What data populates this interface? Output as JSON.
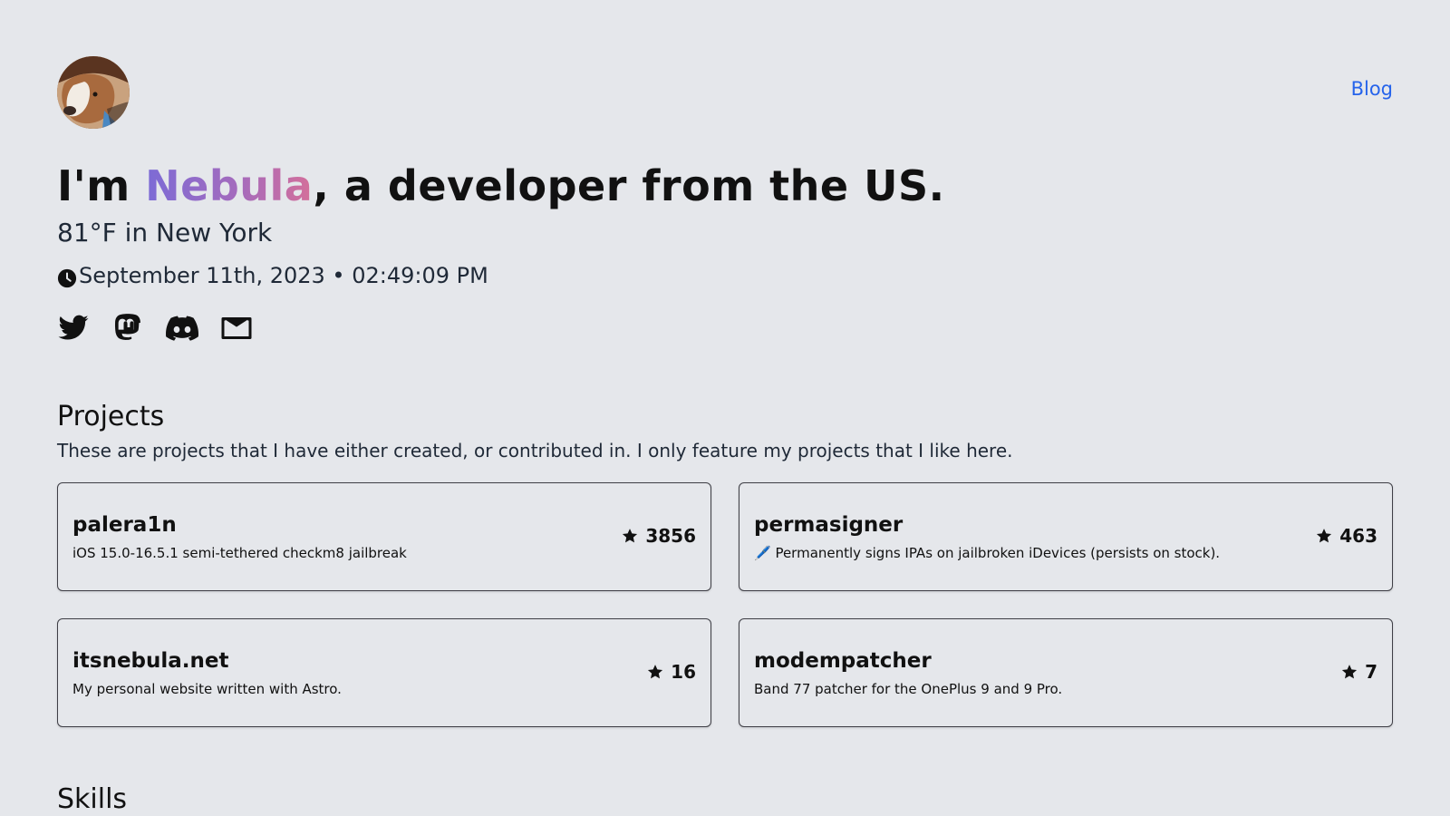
{
  "header": {
    "avatar_icon": "dog-avatar",
    "blog_label": "Blog"
  },
  "intro": {
    "prefix": "I'm ",
    "name": "Nebula",
    "suffix": ", a developer from the US.",
    "weather": "81°F in New York",
    "clock_icon": "clock-icon",
    "datetime": "September 11th, 2023 • 02:49:09 PM"
  },
  "socials": [
    {
      "icon": "twitter-icon"
    },
    {
      "icon": "mastodon-icon"
    },
    {
      "icon": "discord-icon"
    },
    {
      "icon": "email-icon"
    }
  ],
  "projects": {
    "title": "Projects",
    "description": "These are projects that I have either created, or contributed in. I only feature my projects that I like here.",
    "items": [
      {
        "name": "palera1n",
        "description": "iOS 15.0-16.5.1 semi-tethered checkm8 jailbreak",
        "stars": "3856"
      },
      {
        "name": "permasigner",
        "description": "🖊️ Permanently signs IPAs on jailbroken iDevices (persists on stock).",
        "stars": "463"
      },
      {
        "name": "itsnebula.net",
        "description": "My personal website written with Astro.",
        "stars": "16"
      },
      {
        "name": "modempatcher",
        "description": "Band 77 patcher for the OnePlus 9 and 9 Pro.",
        "stars": "7"
      }
    ]
  },
  "skills": {
    "title": "Skills"
  },
  "colors": {
    "background": "#e5e7eb",
    "link": "#2563eb",
    "name_gradient_start": "#7c6bd6",
    "name_gradient_end": "#d46f9a"
  }
}
